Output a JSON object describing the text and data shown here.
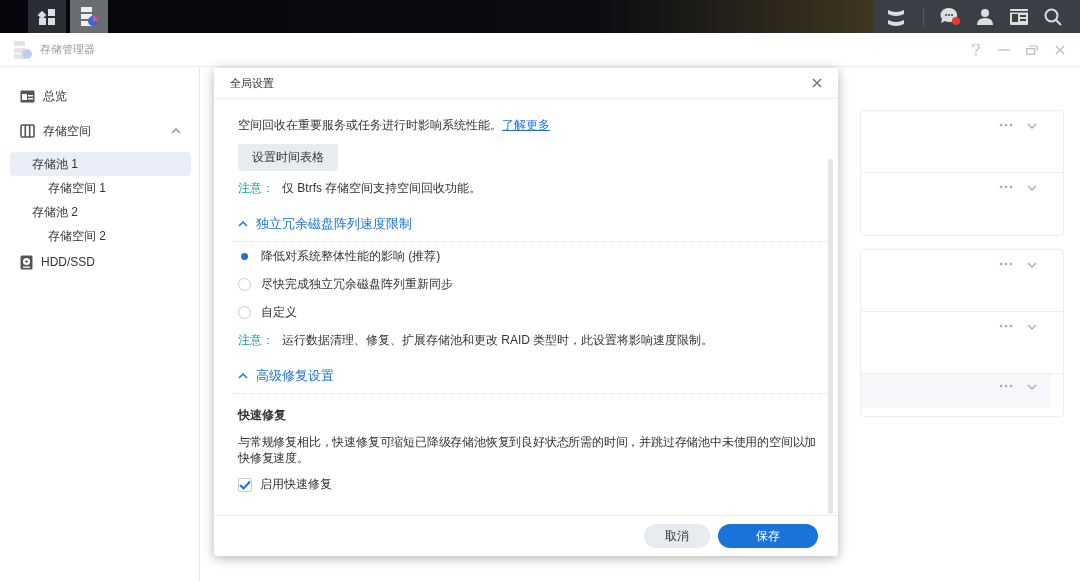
{
  "taskbar": {
    "apps": [
      {
        "kind": "grid",
        "selected": false
      },
      {
        "kind": "storage",
        "selected": true
      }
    ],
    "notification": true
  },
  "window": {
    "title": "存储管理器"
  },
  "sidebar": {
    "items": [
      {
        "label": "总览",
        "kind": "overview",
        "selected": false
      },
      {
        "label": "存储空间",
        "kind": "storage",
        "selected": false,
        "expanded": true,
        "children": [
          {
            "label": "存储池 1",
            "selected": true,
            "children": [
              {
                "label": "存储空间 1",
                "selected": false
              }
            ]
          },
          {
            "label": "存储池 2",
            "selected": false,
            "children": [
              {
                "label": "存储空间 2",
                "selected": false
              }
            ]
          }
        ]
      },
      {
        "label": "HDD/SSD",
        "kind": "disk",
        "selected": false
      }
    ]
  },
  "cards": [
    {
      "rows": [
        {
          "selected": false
        },
        {
          "selected": false
        }
      ]
    },
    {
      "rows": [
        {
          "selected": false
        },
        {
          "selected": false
        },
        {
          "selected": true
        }
      ]
    }
  ],
  "dialog": {
    "title": "全局设置",
    "intro": "空间回收在重要服务或任务进行时影响系统性能。",
    "link": "了解更多",
    "schedule_button": "设置时间表格",
    "note": {
      "label": "注意：",
      "text": "仅 Btrfs 存储空间支持空间回收功能。"
    },
    "sections": [
      {
        "title": "独立冗余磁盘阵列速度限制",
        "expanded": true,
        "options": [
          {
            "label": "降低对系统整体性能的影响 (推荐)",
            "selected": true
          },
          {
            "label": "尽快完成独立冗余磁盘阵列重新同步",
            "selected": false
          },
          {
            "label": "自定义",
            "selected": false
          }
        ],
        "note": {
          "label": "注意：",
          "text": "运行数据清理、修复、扩展存储池和更改 RAID 类型时，此设置将影响速度限制。"
        }
      },
      {
        "title": "高级修复设置",
        "expanded": true,
        "heading": "快速修复",
        "description": "与常规修复相比，快速修复可缩短已降级存储池恢复到良好状态所需的时间，并跳过存储池中未使用的空间以加快修复速度。",
        "checkbox": {
          "label": "启用快速修复",
          "checked": true
        }
      }
    ],
    "buttons": [
      {
        "label": "取消",
        "kind": "secondary"
      },
      {
        "label": "保存",
        "kind": "primary"
      }
    ]
  }
}
